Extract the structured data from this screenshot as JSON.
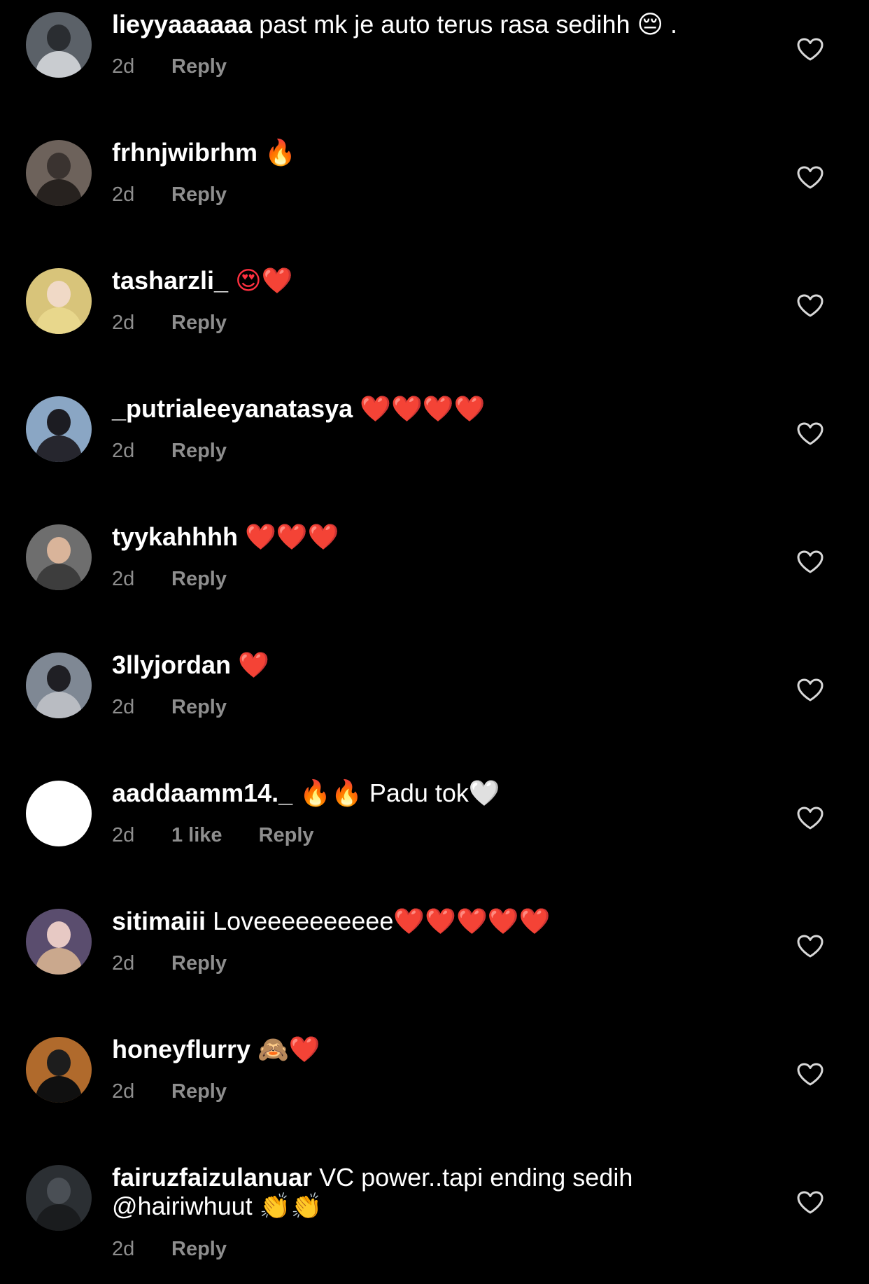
{
  "colors": {
    "background": "#000000",
    "username": "#ffffff",
    "meta_text": "#8e8e8e",
    "heart_outline": "#d8d8d8",
    "emoji_red_heart": "#ff3040"
  },
  "comments": [
    {
      "username": "lieyyaaaaaa",
      "text": "past mk je auto terus rasa sedihh 😔 .",
      "time": "2d",
      "likes": "",
      "reply_label": "Reply",
      "avatar_icon": "avatar-photo"
    },
    {
      "username": "frhnjwibrhm",
      "text": "🔥",
      "time": "2d",
      "likes": "",
      "reply_label": "Reply",
      "avatar_icon": "avatar-photo"
    },
    {
      "username": "tasharzli_",
      "text": "😍❤️",
      "time": "2d",
      "likes": "",
      "reply_label": "Reply",
      "avatar_icon": "avatar-photo"
    },
    {
      "username": "_putrialeeyanatasya",
      "text": "❤️❤️❤️❤️",
      "time": "2d",
      "likes": "",
      "reply_label": "Reply",
      "avatar_icon": "avatar-photo"
    },
    {
      "username": "tyykahhhh",
      "text": "❤️❤️❤️",
      "time": "2d",
      "likes": "",
      "reply_label": "Reply",
      "avatar_icon": "avatar-photo"
    },
    {
      "username": "3llyjordan",
      "text": "❤️",
      "time": "2d",
      "likes": "",
      "reply_label": "Reply",
      "avatar_icon": "avatar-photo"
    },
    {
      "username": "aaddaamm14._",
      "text": "🔥🔥 Padu tok🤍",
      "time": "2d",
      "likes": "1 like",
      "reply_label": "Reply",
      "avatar_icon": "avatar-white"
    },
    {
      "username": "sitimaiii",
      "text": "Loveeeeeeeeee❤️❤️❤️❤️❤️",
      "time": "2d",
      "likes": "",
      "reply_label": "Reply",
      "avatar_icon": "avatar-photo"
    },
    {
      "username": "honeyflurry",
      "text": "🙈❤️",
      "time": "2d",
      "likes": "",
      "reply_label": "Reply",
      "avatar_icon": "avatar-photo"
    },
    {
      "username": "fairuzfaizulanuar",
      "text": "VC power..tapi ending sedih",
      "text_line2": "@hairiwhuut 👏👏",
      "time": "2d",
      "likes": "",
      "reply_label": "Reply",
      "avatar_icon": "avatar-photo"
    }
  ]
}
